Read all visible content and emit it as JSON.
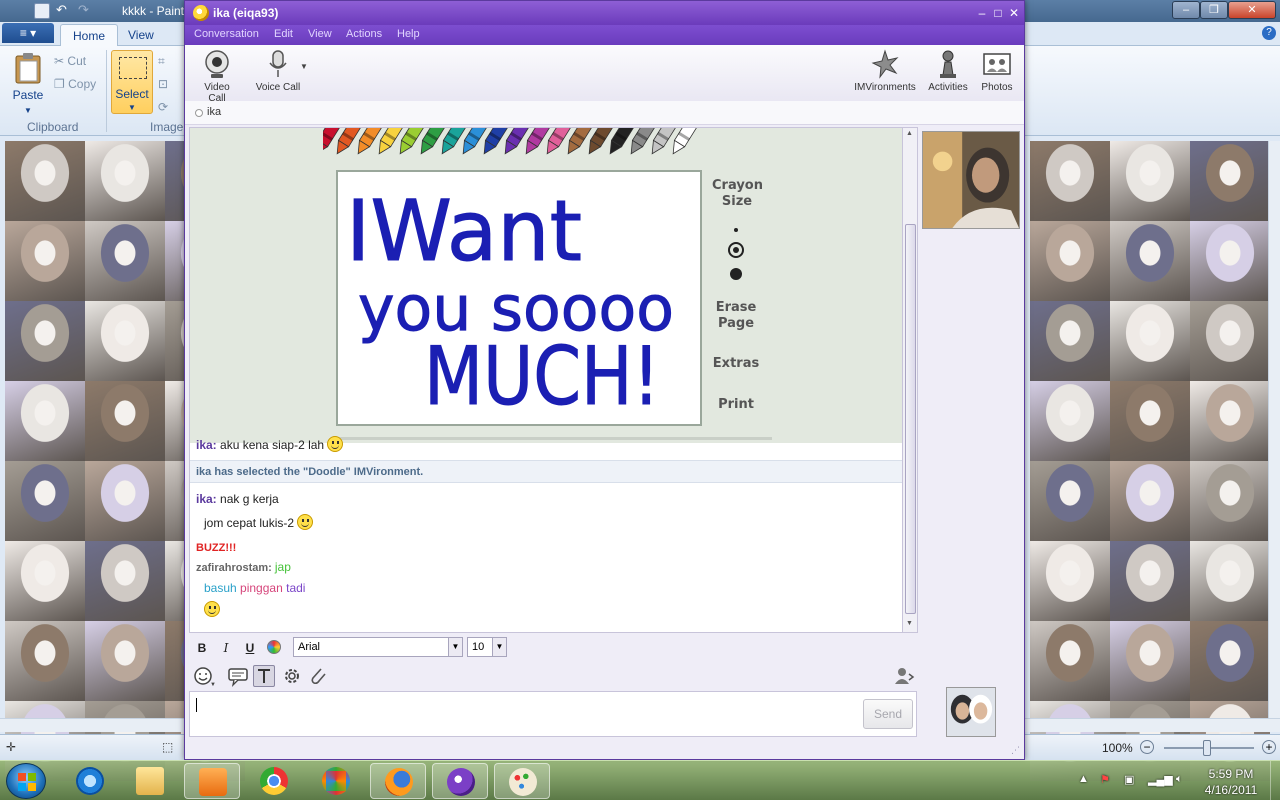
{
  "paint": {
    "title": "kkkk - Paint",
    "app_menu": "≡ ▾",
    "tabs": [
      "Home",
      "View"
    ],
    "clipboard": {
      "paste": "Paste",
      "cut": "Cut",
      "copy": "Copy",
      "group": "Clipboard"
    },
    "image": {
      "select": "Select",
      "group": "Image"
    },
    "zoom": "100%"
  },
  "ym": {
    "title": "ika (eiqa93)",
    "menu": [
      "Conversation",
      "Edit",
      "View",
      "Actions",
      "Help"
    ],
    "toolbar": {
      "video_call": "Video Call",
      "voice_call": "Voice Call",
      "imvironments": "IMVironments",
      "activities": "Activities",
      "photos": "Photos"
    },
    "contact_status": "ika",
    "doodle": {
      "crayon_size_1": "Crayon",
      "crayon_size_2": "Size",
      "erase_1": "Erase",
      "erase_2": "Page",
      "extras": "Extras",
      "print": "Print",
      "drawing_text_line1": "IWant",
      "drawing_text_line2": "you soooo",
      "drawing_text_line3": "MUCH!"
    },
    "messages": {
      "m0_sender": "ika:",
      "m0_text": "aku kena siap-2 lah",
      "system": "ika has selected the \"Doodle\" IMVironment.",
      "m1_sender": "ika:",
      "m1_text": "nak g kerja",
      "m2_text": "jom cepat lukis-2",
      "buzz": "BUZZ!!!",
      "m3_sender": "zafirahrostam:",
      "m3_text": "jap",
      "m4_word1": "basuh",
      "m4_word2": "pinggan",
      "m4_word3": "tadi"
    },
    "format": {
      "bold": "B",
      "italic": "I",
      "underline": "U",
      "font": "Arial",
      "size": "10"
    },
    "send": "Send"
  },
  "taskbar": {
    "time": "5:59 PM",
    "date": "4/16/2011"
  },
  "colors": {
    "ym_purple": "#6b3bbb",
    "ink_blue": "#1b1fb3",
    "buzz_red": "#e02424"
  }
}
